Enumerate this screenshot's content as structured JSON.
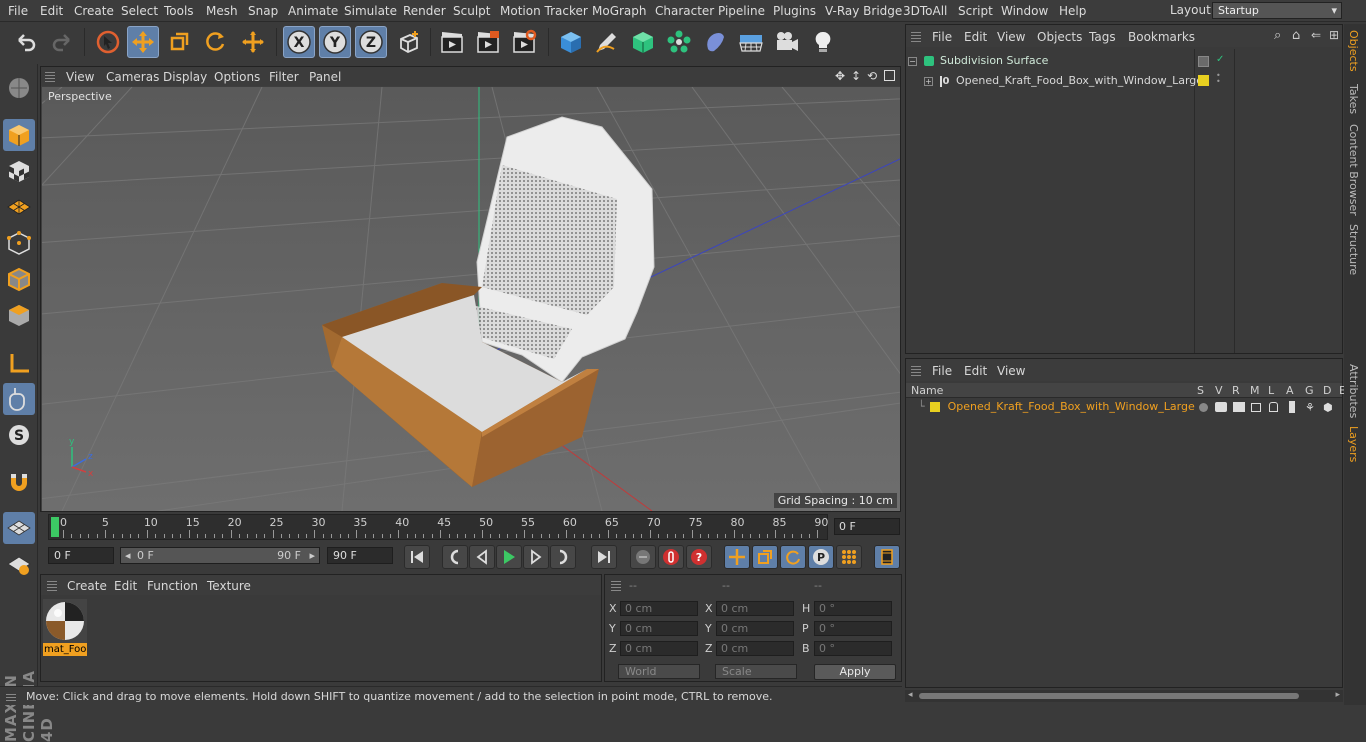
{
  "menubar": {
    "items": [
      "File",
      "Edit",
      "Create",
      "Select",
      "Tools",
      "Mesh",
      "Snap",
      "Animate",
      "Simulate",
      "Render",
      "Sculpt",
      "Motion Tracker",
      "MoGraph",
      "Character",
      "Pipeline",
      "Plugins",
      "V-Ray Bridge",
      "3DToAll",
      "Script",
      "Window",
      "Help"
    ],
    "layout_label": "Layout:",
    "layout_value": "Startup"
  },
  "toolbar": {
    "icons": [
      "undo-icon",
      "redo-icon",
      "select-arrow-icon",
      "move-icon",
      "scale-icon",
      "rotate-icon",
      "live-move-icon",
      "x-axis-icon",
      "y-axis-icon",
      "z-axis-icon",
      "coordinate-system-icon",
      "render-view-icon",
      "render-picture-viewer-icon",
      "edit-render-settings-icon",
      "cube-icon",
      "pen-icon",
      "generator-icon",
      "cloner-icon",
      "deformer-icon",
      "floor-icon",
      "camera-icon",
      "light-icon"
    ],
    "axis_labels": [
      "X",
      "Y",
      "Z"
    ]
  },
  "viewport": {
    "menu": [
      "View",
      "Cameras",
      "Display",
      "Options",
      "Filter",
      "Panel"
    ],
    "label": "Perspective",
    "grid_spacing": "Grid Spacing : 10 cm"
  },
  "timeline": {
    "ticks": [
      "0",
      "5",
      "10",
      "15",
      "20",
      "25",
      "30",
      "35",
      "40",
      "45",
      "50",
      "55",
      "60",
      "65",
      "70",
      "75",
      "80",
      "85",
      "90"
    ],
    "current_frame": "0 F"
  },
  "transport": {
    "start_field": "0 F",
    "range_start": "0 F",
    "range_end": "90 F",
    "end_field": "90 F"
  },
  "materials": {
    "menu": [
      "Create",
      "Edit",
      "Function",
      "Texture"
    ],
    "items": [
      {
        "name": "mat_Foo"
      }
    ]
  },
  "coordinates": {
    "headers": [
      "--",
      "--",
      "--"
    ],
    "rows": [
      {
        "l1": "X",
        "v1": "0 cm",
        "l2": "X",
        "v2": "0 cm",
        "l3": "H",
        "v3": "0 °"
      },
      {
        "l1": "Y",
        "v1": "0 cm",
        "l2": "Y",
        "v2": "0 cm",
        "l3": "P",
        "v3": "0 °"
      },
      {
        "l1": "Z",
        "v1": "0 cm",
        "l2": "Z",
        "v2": "0 cm",
        "l3": "B",
        "v3": "0 °"
      }
    ],
    "mode": "World",
    "size_mode": "Scale",
    "apply": "Apply"
  },
  "status": {
    "text": "Move: Click and drag to move elements. Hold down SHIFT to quantize movement / add to the selection in point mode, CTRL to remove."
  },
  "objects_panel": {
    "menu": [
      "File",
      "Edit",
      "View",
      "Objects",
      "Tags",
      "Bookmarks"
    ],
    "objects": [
      {
        "name": "Subdivision Surface"
      },
      {
        "name": "Opened_Kraft_Food_Box_with_Window_Large"
      }
    ]
  },
  "layers_panel": {
    "menu": [
      "File",
      "Edit",
      "View"
    ],
    "columns": [
      "Name",
      "S",
      "V",
      "R",
      "M",
      "L",
      "A",
      "G",
      "D",
      "E"
    ],
    "layers": [
      {
        "name": "Opened_Kraft_Food_Box_with_Window_Large",
        "color": "#e8d020"
      }
    ]
  },
  "side_tabs": [
    "Objects",
    "Takes",
    "Content Browser",
    "Structure",
    "Attributes",
    "Layers"
  ],
  "brand": "MAXON CINEMA 4D",
  "colors": {
    "accent": "#f0a020",
    "selected_tool": "#5f7fa8",
    "layer_yellow": "#e8d020",
    "object_green": "#2ec27e"
  }
}
